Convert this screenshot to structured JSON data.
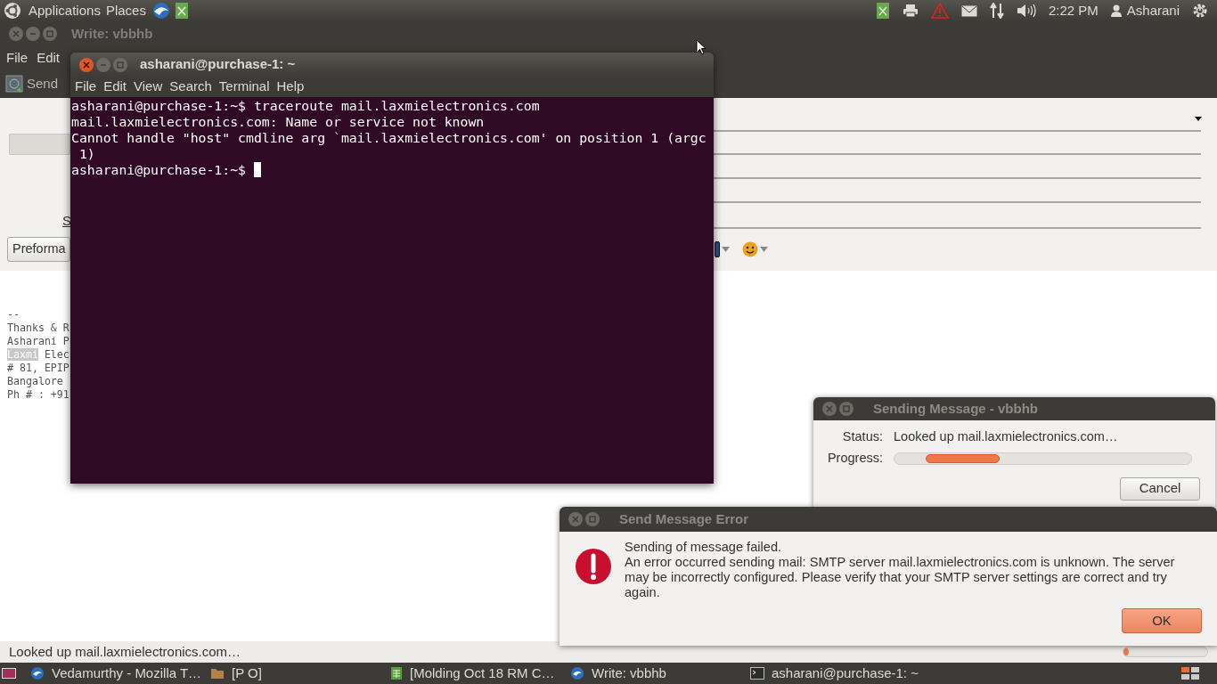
{
  "top_panel": {
    "menus": [
      "Applications",
      "Places"
    ],
    "clock": "2:22 PM",
    "user": "Asharani"
  },
  "compose_window": {
    "title": "Write: vbbhb",
    "menus": [
      "File",
      "Edit"
    ],
    "send_button": "Send",
    "subject_label": "S",
    "format_button": "Preforma",
    "signature": [
      [
        {
          "text": "--",
          "highlighted": false
        }
      ],
      [
        {
          "text": "Thanks & R",
          "highlighted": false
        }
      ],
      [
        {
          "text": "Asharani P",
          "highlighted": false
        }
      ],
      [
        {
          "text": "Laxmi",
          "highlighted": true
        },
        {
          "text": " Elec",
          "highlighted": false
        }
      ],
      [
        {
          "text": "# 81, EPIP",
          "highlighted": false
        }
      ],
      [
        {
          "text": "Bangalore",
          "highlighted": false
        }
      ],
      [
        {
          "text": "Ph # : +91",
          "highlighted": false
        }
      ]
    ],
    "status": "Looked up mail.laxmielectronics.com…"
  },
  "terminal": {
    "title": "asharani@purchase-1: ~",
    "menus": [
      "File",
      "Edit",
      "View",
      "Search",
      "Terminal",
      "Help"
    ],
    "lines": [
      "asharani@purchase-1:~$ traceroute mail.laxmielectronics.com",
      "mail.laxmielectronics.com: Name or service not known",
      "Cannot handle \"host\" cmdline arg `mail.laxmielectronics.com' on position 1 (argc",
      " 1)",
      "asharani@purchase-1:~$ "
    ]
  },
  "sending_dialog": {
    "title": "Sending Message - vbbhb",
    "status_label": "Status:",
    "status": "Looked up mail.laxmielectronics.com…",
    "progress_label": "Progress:",
    "cancel_button": "Cancel"
  },
  "error_dialog": {
    "title": "Send Message Error",
    "heading": "Sending of message failed.",
    "message": "An error occurred sending mail: SMTP server mail.laxmielectronics.com is unknown. The server may be incorrectly configured. Please verify that your SMTP server settings are correct and try again.",
    "ok_button": "OK"
  },
  "taskbar": {
    "items": [
      {
        "kind": "mail",
        "label": "Vedamurthy - Mozilla T…"
      },
      {
        "kind": "folder",
        "label": "[P O]"
      },
      {
        "kind": "spreadsheet",
        "label": "[Molding Oct 18 RM  C…"
      },
      {
        "kind": "mail",
        "label": "Write: vbbhb"
      },
      {
        "kind": "terminal",
        "label": "asharani@purchase-1: ~"
      }
    ]
  }
}
